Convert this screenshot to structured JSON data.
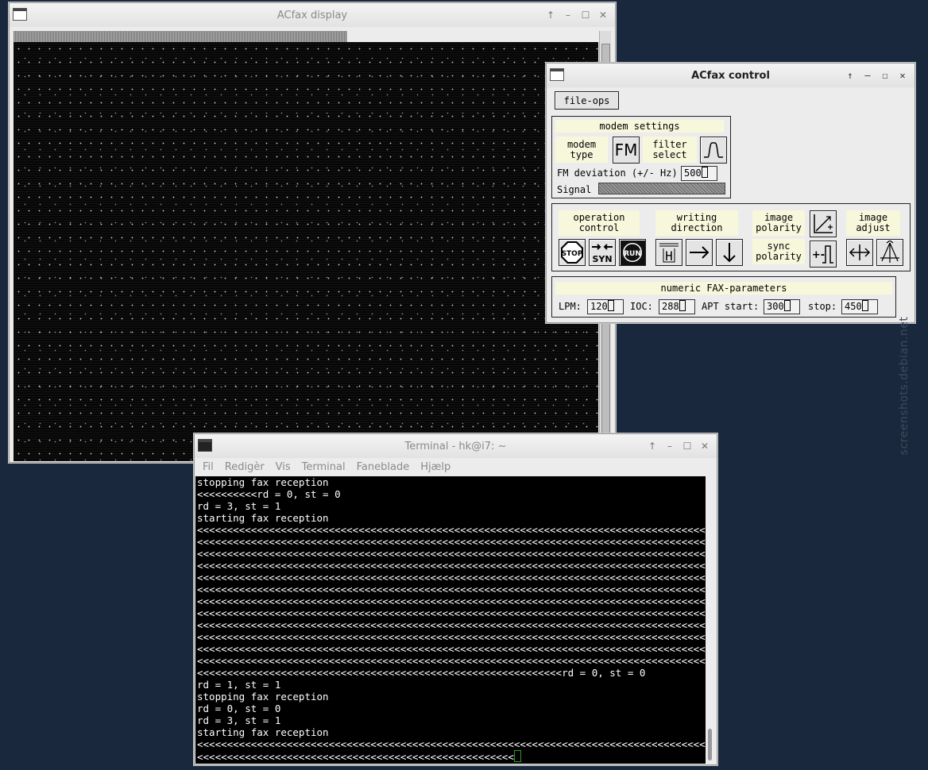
{
  "display_window": {
    "title": "ACfax display",
    "progress_fraction": 0.57
  },
  "control_window": {
    "title": "ACfax control",
    "file_ops": "file-ops",
    "modem_settings": {
      "header": "modem settings",
      "modem_type_label": "modem type",
      "modem_type_value": "FM",
      "filter_select_label": "filter select",
      "fm_deviation_label": "FM deviation (+/- Hz)",
      "fm_deviation_value": "500",
      "signal_label": "Signal"
    },
    "operation": {
      "operation_control": "operation control",
      "writing_direction": "writing direction",
      "image_polarity": "image polarity",
      "sync_polarity": "sync polarity",
      "image_adjust": "image adjust",
      "stop": "STOP",
      "syn": "SYN",
      "run": "RUN",
      "h": "H",
      "plus_minus": "+-"
    },
    "fax_params": {
      "header": "numeric FAX-parameters",
      "lpm_label": "LPM:",
      "lpm_value": "120",
      "ioc_label": "IOC:",
      "ioc_value": "288",
      "apt_start_label": "APT start:",
      "apt_start_value": "300",
      "stop_label": "stop:",
      "stop_value": "450"
    }
  },
  "terminal_window": {
    "title": "Terminal - hk@i7: ~",
    "menu": [
      "Fil",
      "Redigèr",
      "Vis",
      "Terminal",
      "Faneblade",
      "Hjælp"
    ],
    "lines": [
      "stopping fax reception",
      "<<<<<<<<<<rd = 0, st = 0",
      "rd = 3, st = 1",
      "starting fax reception",
      "<<<<<<<<<<<<<<<<<<<<<<<<<<<<<<<<<<<<<<<<<<<<<<<<<<<<<<<<<<<<<<<<<<<<<<<<<<<<<<<<<<<<<<<<<<<<<<<<<<<<<<<<",
      "<<<<<<<<<<<<<<<<<<<<<<<<<<<<<<<<<<<<<<<<<<<<<<<<<<<<<<<<<<<<<<<<<<<<<<<<<<<<<<<<<<<<<<<<<<<<<<<<<<<<<<<<",
      "<<<<<<<<<<<<<<<<<<<<<<<<<<<<<<<<<<<<<<<<<<<<<<<<<<<<<<<<<<<<<<<<<<<<<<<<<<<<<<<<<<<<<<<<<<<<<<<<<<<<<<<<",
      "<<<<<<<<<<<<<<<<<<<<<<<<<<<<<<<<<<<<<<<<<<<<<<<<<<<<<<<<<<<<<<<<<<<<<<<<<<<<<<<<<<<<<<<<<<<<<<<<<<<<<<<<",
      "<<<<<<<<<<<<<<<<<<<<<<<<<<<<<<<<<<<<<<<<<<<<<<<<<<<<<<<<<<<<<<<<<<<<<<<<<<<<<<<<<<<<<<<<<<<<<<<<<<<<<<<<",
      "<<<<<<<<<<<<<<<<<<<<<<<<<<<<<<<<<<<<<<<<<<<<<<<<<<<<<<<<<<<<<<<<<<<<<<<<<<<<<<<<<<<<<<<<<<<<<<<<<<<<<<<<",
      "<<<<<<<<<<<<<<<<<<<<<<<<<<<<<<<<<<<<<<<<<<<<<<<<<<<<<<<<<<<<<<<<<<<<<<<<<<<<<<<<<<<<<<<<<<<<<<<<<<<<<<<<",
      "<<<<<<<<<<<<<<<<<<<<<<<<<<<<<<<<<<<<<<<<<<<<<<<<<<<<<<<<<<<<<<<<<<<<<<<<<<<<<<<<<<<<<<<<<<<<<<<<<<<<<<<<",
      "<<<<<<<<<<<<<<<<<<<<<<<<<<<<<<<<<<<<<<<<<<<<<<<<<<<<<<<<<<<<<<<<<<<<<<<<<<<<<<<<<<<<<<<<<<<<<<<<<<<<<<<<",
      "<<<<<<<<<<<<<<<<<<<<<<<<<<<<<<<<<<<<<<<<<<<<<<<<<<<<<<<<<<<<<<<<<<<<<<<<<<<<<<<<<<<<<<<<<<<<<<<<<<<<<<<<",
      "<<<<<<<<<<<<<<<<<<<<<<<<<<<<<<<<<<<<<<<<<<<<<<<<<<<<<<<<<<<<<<<<<<<<<<<<<<<<<<<<<<<<<<<<<<<<<<<<<<<<<<<<",
      "<<<<<<<<<<<<<<<<<<<<<<<<<<<<<<<<<<<<<<<<<<<<<<<<<<<<<<<<<<<<<<<<<<<<<<<<<<<<<<<<<<<<<<<<<<<<<<<<<<<<<<<<",
      "<<<<<<<<<<<<<<<<<<<<<<<<<<<<<<<<<<<<<<<<<<<<<<<<<<<<<<<<<<<<<rd = 0, st = 0",
      "rd = 1, st = 1",
      "stopping fax reception",
      "rd = 0, st = 0",
      "rd = 3, st = 1",
      "starting fax reception",
      "<<<<<<<<<<<<<<<<<<<<<<<<<<<<<<<<<<<<<<<<<<<<<<<<<<<<<<<<<<<<<<<<<<<<<<<<<<<<<<<<<<<<<<<<<<<<<<<<<<<<<<<<",
      "<<<<<<<<<<<<<<<<<<<<<<<<<<<<<<<<<<<<<<<<<<<<<<<<<<<<<"
    ]
  },
  "watermark": "screenshots.debian.net"
}
